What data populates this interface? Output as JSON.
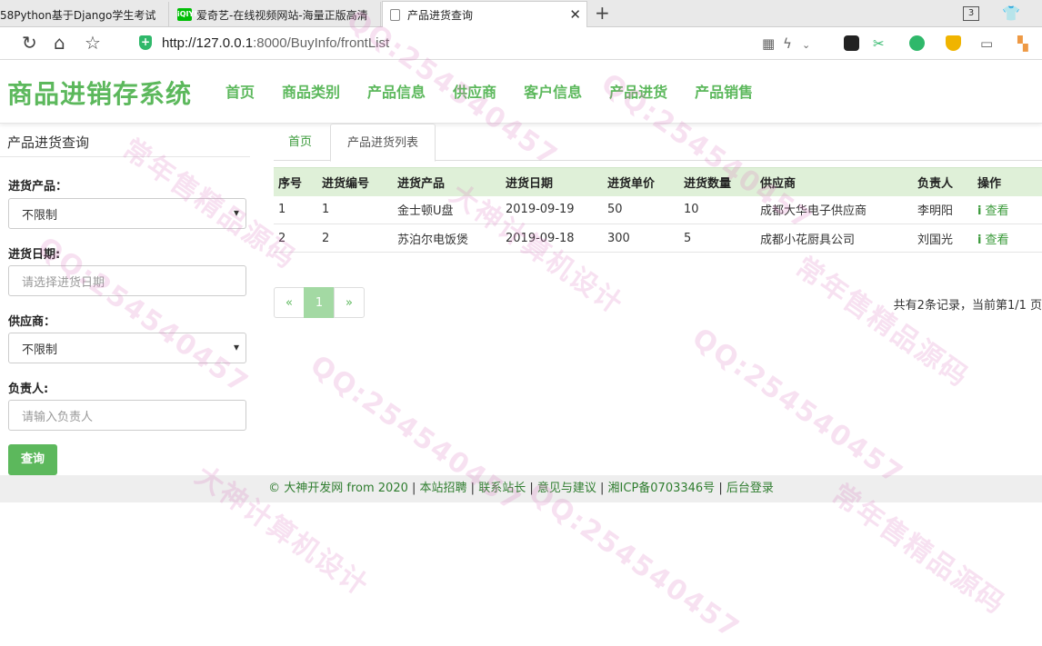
{
  "browser": {
    "tabs": [
      {
        "title": "58Python基于Django学生考试"
      },
      {
        "title": "爱奇艺-在线视频网站-海量正版高清"
      },
      {
        "title": "产品进货查询"
      }
    ],
    "iqiyi_favicon": "iQIYI",
    "tab_count": "3",
    "url_host": "http://127.0.0.1",
    "url_rest": ":8000/BuyInfo/frontList"
  },
  "header": {
    "brand": "商品进销存系统",
    "nav": [
      "首页",
      "商品类别",
      "产品信息",
      "供应商",
      "客户信息",
      "产品进货",
      "产品销售"
    ]
  },
  "search": {
    "panel_title": "产品进货查询",
    "product_label": "进货产品：",
    "product_value": "不限制",
    "date_label": "进货日期:",
    "date_placeholder": "请选择进货日期",
    "supplier_label": "供应商：",
    "supplier_value": "不限制",
    "manager_label": "负责人:",
    "manager_placeholder": "请输入负责人",
    "query_button": "查询"
  },
  "list": {
    "tab_home": "首页",
    "tab_active": "产品进货列表",
    "columns": [
      "序号",
      "进货编号",
      "进货产品",
      "进货日期",
      "进货单价",
      "进货数量",
      "供应商",
      "负责人",
      "操作"
    ],
    "rows": [
      {
        "seq": "1",
        "no": "1",
        "product": "金士顿U盘",
        "date": "2019-09-19",
        "price": "50",
        "qty": "10",
        "supplier": "成都大华电子供应商",
        "manager": "李明阳",
        "action": "查看"
      },
      {
        "seq": "2",
        "no": "2",
        "product": "苏泊尔电饭煲",
        "date": "2019-09-18",
        "price": "300",
        "qty": "5",
        "supplier": "成都小花厨具公司",
        "manager": "刘国光",
        "action": "查看"
      }
    ],
    "pager": {
      "prev": "«",
      "current": "1",
      "next": "»"
    },
    "page_info": "共有2条记录，当前第1/1 页"
  },
  "footer": {
    "copyright": "© 大神开发网 from 2020",
    "sep": " | ",
    "links": [
      "本站招聘",
      "联系站长",
      "意见与建议",
      "湘ICP备0703346号",
      "后台登录"
    ]
  },
  "watermark": {
    "texts": [
      "QQ:254540457",
      "大神计算机设计",
      "常年售精品源码"
    ]
  },
  "colors": {
    "accent": "#5cb85c",
    "table_header_bg": "#dff0d8",
    "watermark": "#e89ad0"
  }
}
